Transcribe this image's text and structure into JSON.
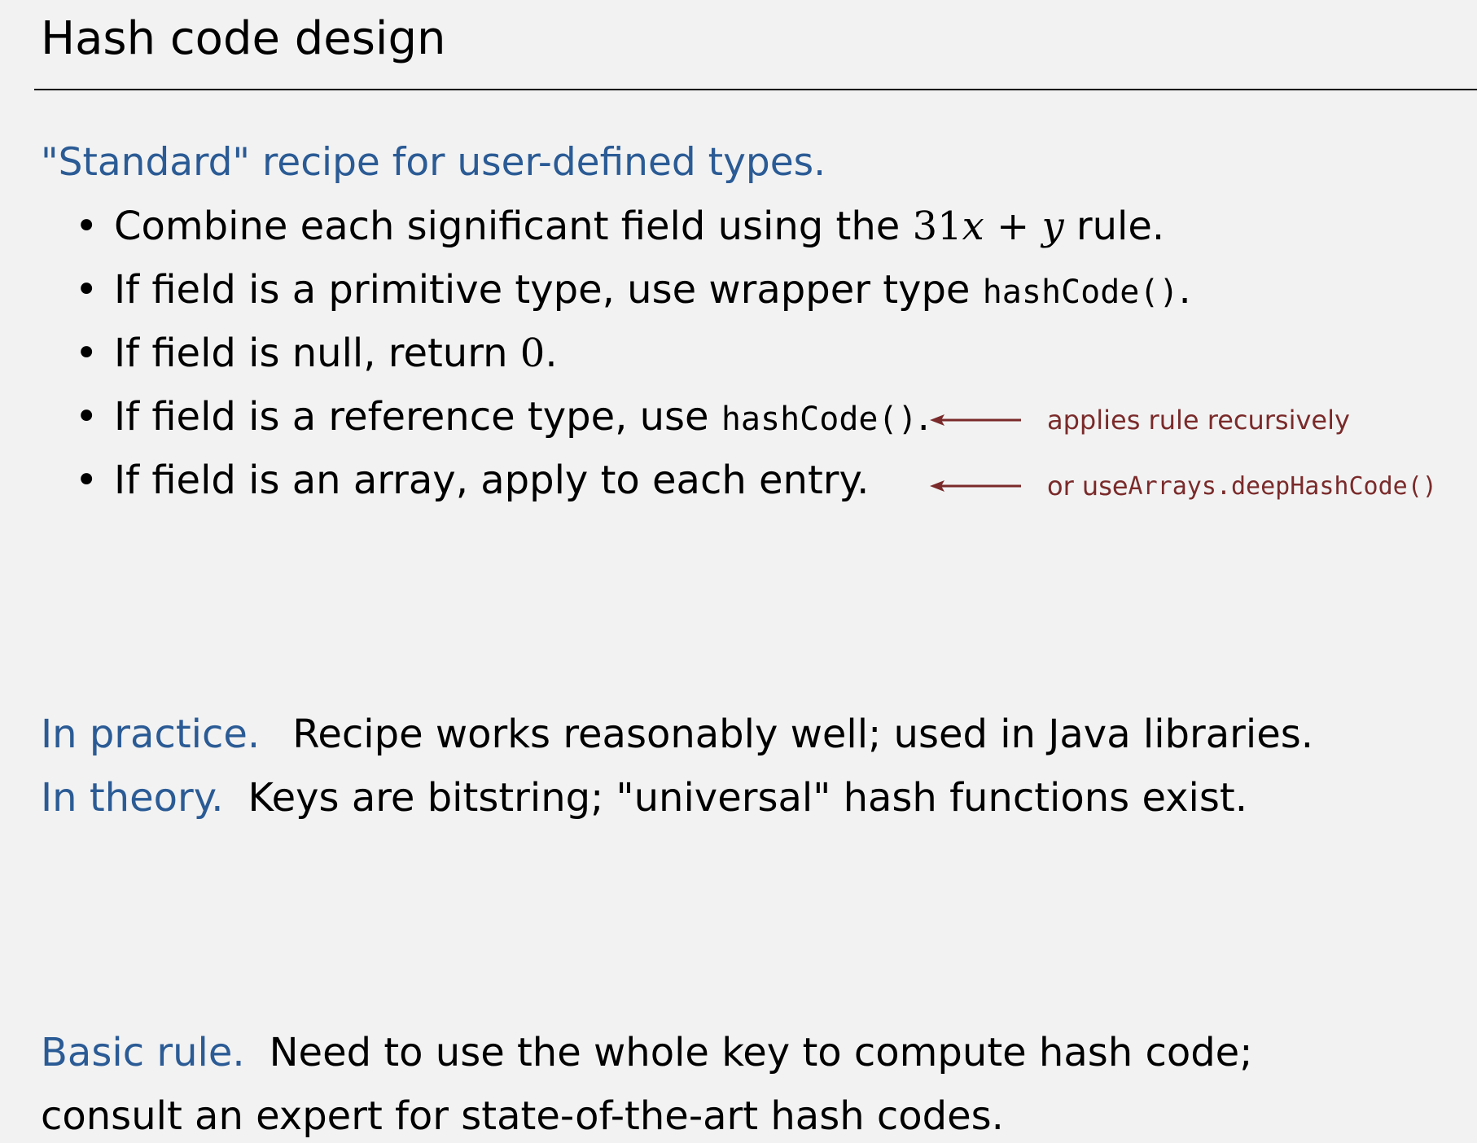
{
  "title": "Hash code design",
  "recipe": {
    "heading": "\"Standard\" recipe for user-defined types.",
    "bullet_symbol": "•",
    "items": [
      {
        "before": "Combine each significant field using the ",
        "math_num": "31",
        "math_var_x": "x",
        "math_op": " + ",
        "math_var_y": "y",
        "after": " rule."
      },
      {
        "before": "If field is a primitive type, use wrapper type ",
        "code": "hashCode()",
        "after": "."
      },
      {
        "before": "If field is null, return ",
        "math_value": "0",
        "after": "."
      },
      {
        "before": "If field is a reference type, use ",
        "code": "hashCode()",
        "after": "."
      },
      {
        "text": "If field is an array, apply to each entry."
      }
    ],
    "annotations": [
      {
        "text": "applies rule recursively"
      },
      {
        "prefix": "or use ",
        "code": "Arrays.deepHashCode()"
      }
    ]
  },
  "practice": {
    "lead": "In practice.",
    "text": "Recipe works reasonably well; used in Java libraries."
  },
  "theory": {
    "lead": "In theory.",
    "text": "Keys are bitstring; \"universal\" hash functions exist."
  },
  "basic_rule": {
    "lead": "Basic rule.",
    "line1": "Need to use the whole key to compute hash code;",
    "line2": "consult an expert for state-of-the-art hash codes."
  },
  "colors": {
    "background": "#f2f2f2",
    "heading_blue": "#2b5b95",
    "annotation_red": "#7a2a2a",
    "text": "#000000"
  },
  "icons": [
    "left-arrow-icon"
  ]
}
